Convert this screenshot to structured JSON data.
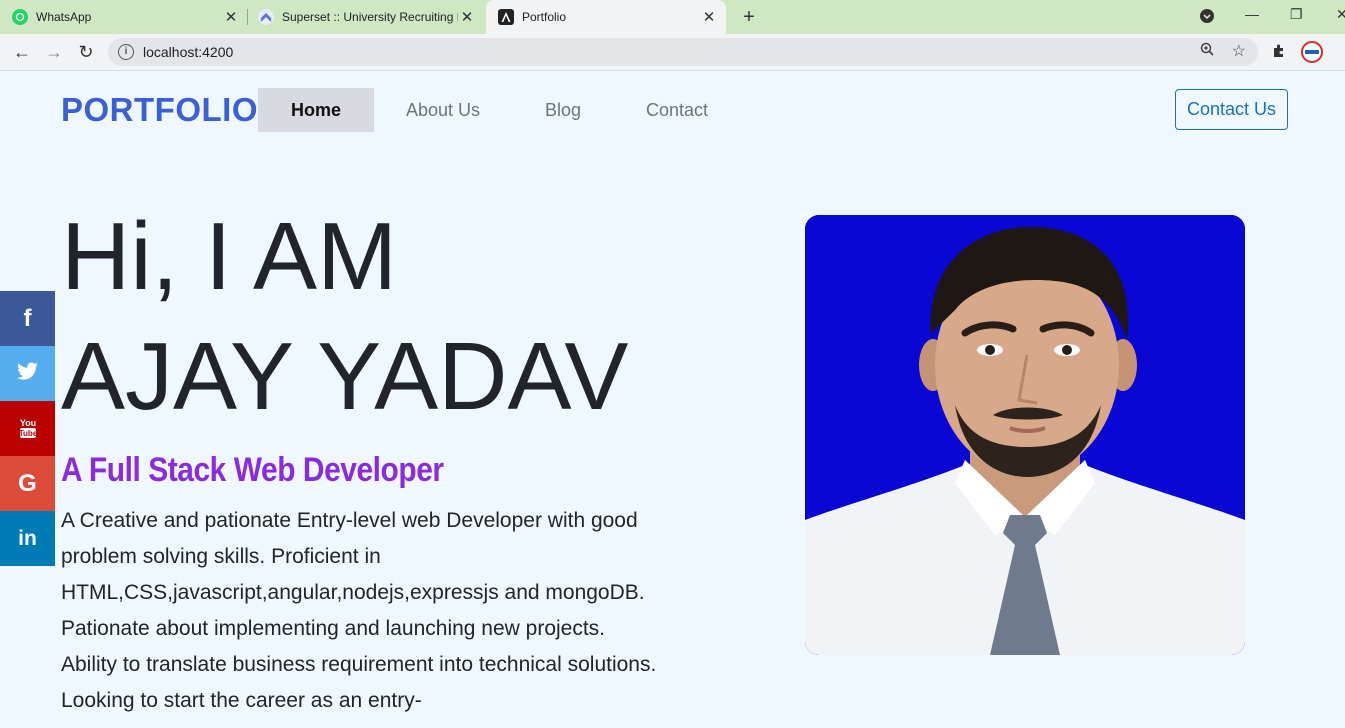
{
  "browser": {
    "tabs": [
      {
        "title": "WhatsApp"
      },
      {
        "title": "Superset :: University Recruiting P"
      },
      {
        "title": "Portfolio"
      }
    ],
    "url": "localhost:4200"
  },
  "nav": {
    "brand": "PORTFOLIO",
    "links": [
      "Home",
      "About Us",
      "Blog",
      "Contact"
    ],
    "cta": "Contact Us"
  },
  "social": [
    "facebook",
    "twitter",
    "youtube",
    "google",
    "linkedin"
  ],
  "hero": {
    "line1": "Hi, I AM",
    "line2": "AJAY YADAV",
    "role": "A Full Stack Web Developer",
    "bio": "A Creative and pationate Entry-level web Developer with good problem solving skills. Proficient in HTML,CSS,javascript,angular,nodejs,expressjs and mongoDB. Pationate about implementing and launching new projects. Ability to translate business requirement into technical solutions. Looking to start the career as an entry-"
  },
  "colors": {
    "brand": "#3b5fd8",
    "role": "#8a2be2",
    "photo_bg": "#0a07d4"
  }
}
